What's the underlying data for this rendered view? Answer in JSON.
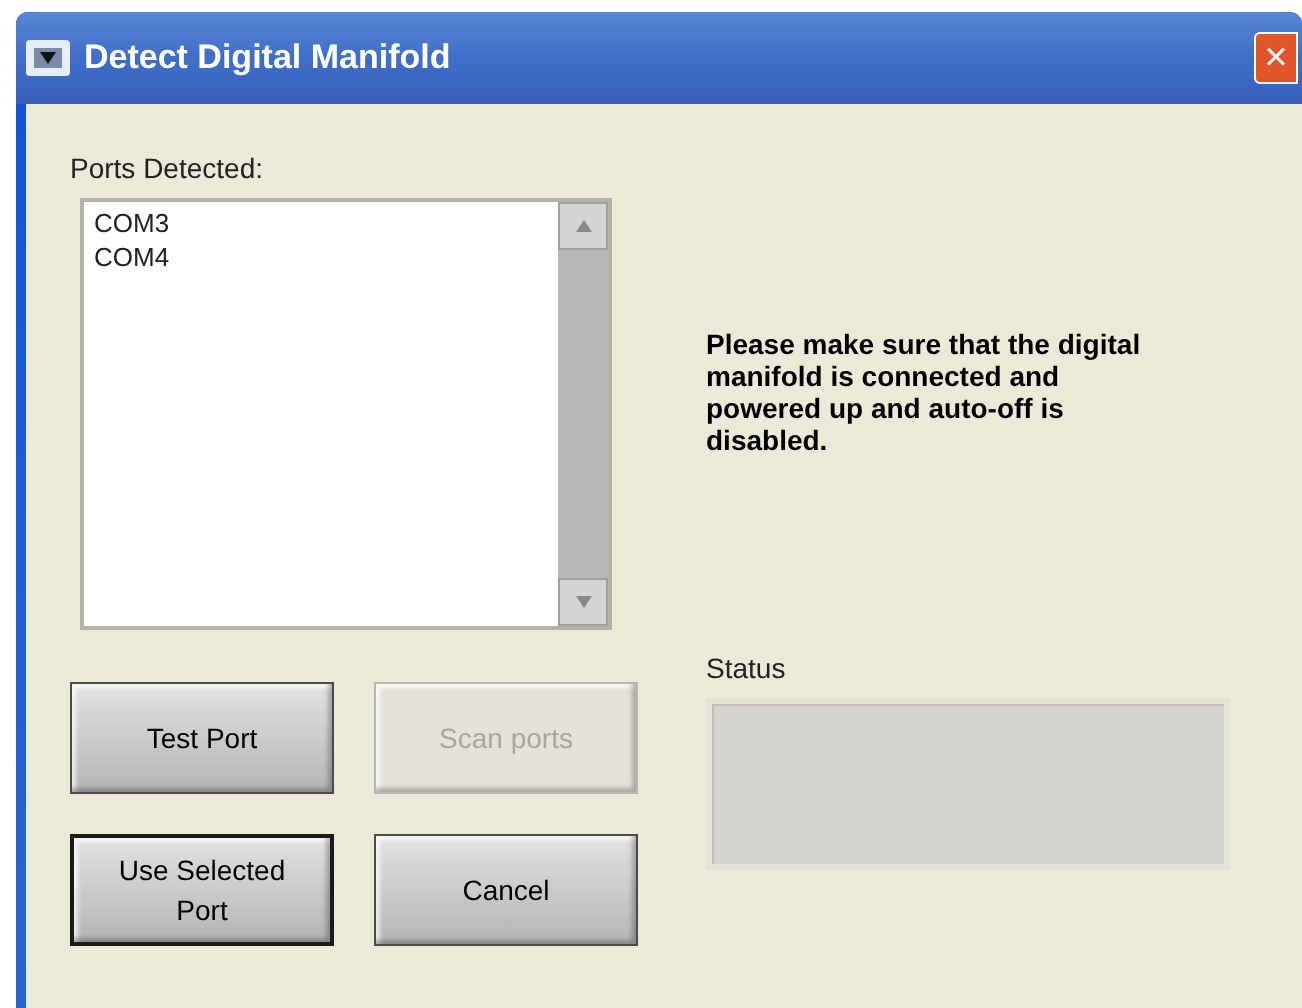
{
  "window": {
    "title": "Detect Digital Manifold",
    "close": "×"
  },
  "ports": {
    "label": "Ports Detected:",
    "items": [
      {
        "text": "COM3",
        "selected": false
      },
      {
        "text": "COM4",
        "selected": false
      }
    ]
  },
  "message": "Please make sure that the digital manifold is connected and powered up and auto-off is disabled.",
  "buttons": [
    {
      "label": "Test Port",
      "disabled": false,
      "default": false
    },
    {
      "label": "Scan ports",
      "disabled": true,
      "default": false
    },
    {
      "label": "Use Selected Port",
      "disabled": false,
      "default": true
    },
    {
      "label": "Cancel",
      "disabled": false,
      "default": false
    }
  ],
  "status": {
    "label": "Status"
  }
}
